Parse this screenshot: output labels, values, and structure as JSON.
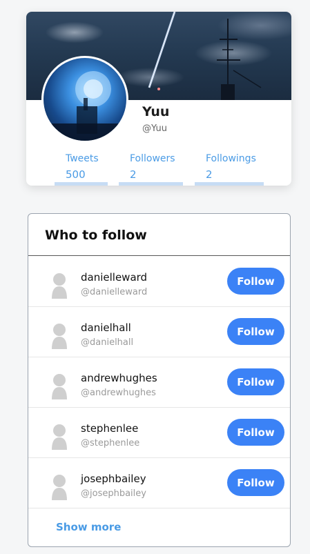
{
  "profile": {
    "name": "Yuu",
    "handle": "@Yuu",
    "stats": [
      {
        "label": "Tweets",
        "value": "500"
      },
      {
        "label": "Followers",
        "value": "2"
      },
      {
        "label": "Followings",
        "value": "2"
      }
    ]
  },
  "who_to_follow": {
    "title": "Who to follow",
    "follow_label": "Follow",
    "show_more_label": "Show more",
    "users": [
      {
        "name": "danielleward",
        "handle": "@danielleward"
      },
      {
        "name": "danielhall",
        "handle": "@danielhall"
      },
      {
        "name": "andrewhughes",
        "handle": "@andrewhughes"
      },
      {
        "name": "stephenlee",
        "handle": "@stephenlee"
      },
      {
        "name": "josephbailey",
        "handle": "@josephbailey"
      }
    ]
  },
  "colors": {
    "accent": "#3b82f6",
    "link": "#4a9be5"
  },
  "icons": {
    "user_avatar": "default-user-icon"
  }
}
